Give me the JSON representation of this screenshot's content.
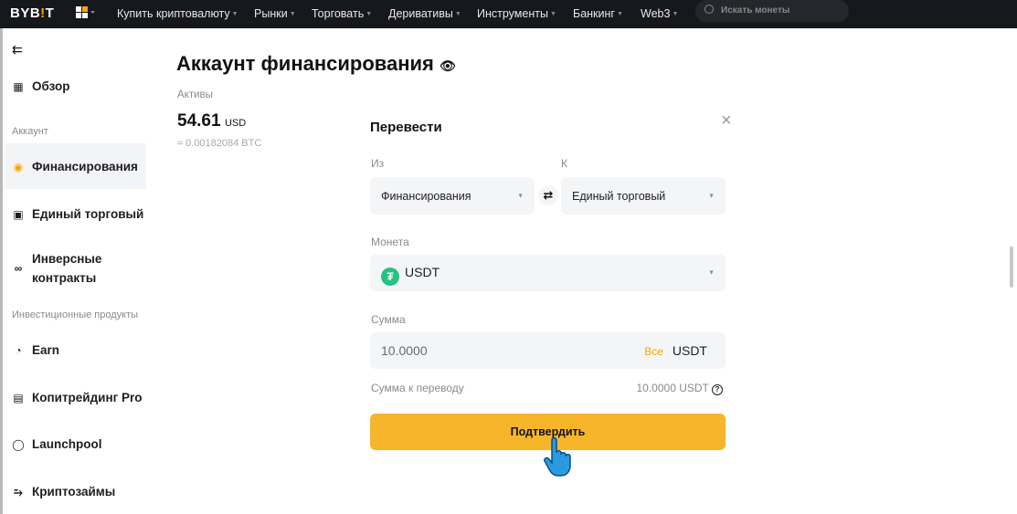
{
  "topbar": {
    "logo": "BYBIT",
    "nav": [
      "Купить криптовалюту",
      "Рынки",
      "Торговать",
      "Деривативы",
      "Инструменты",
      "Банкинг",
      "Web3"
    ],
    "search_placeholder": "Искать монеты"
  },
  "sidebar": {
    "overview": "Обзор",
    "account_label": "Аккаунт",
    "funding": "Финансирования",
    "unified": "Единый торговый",
    "inverse": [
      "Инверсные",
      "контракты"
    ],
    "invest_label": "Инвестиционные продукты",
    "earn": "Earn",
    "copy": "Копитрейдинг Pro",
    "launchpool": "Launchpool",
    "loans": "Криптозаймы"
  },
  "main": {
    "title": "Аккаунт финансирования",
    "assets_label": "Активы",
    "balance": "54.61",
    "balance_currency": "USD",
    "btc_equiv": "≈ 0.00182084 BTC"
  },
  "modal": {
    "title": "Перевести",
    "from_label": "Из",
    "to_label": "К",
    "from_value": "Финансирования",
    "to_value": "Единый торговый",
    "coin_label": "Монета",
    "coin_value": "USDT",
    "amount_label": "Сумма",
    "amount_value": "10.0000",
    "all_label": "Все",
    "amount_currency": "USDT",
    "transfer_label": "Сумма к переводу",
    "transfer_value": "10.0000 USDT",
    "confirm": "Подтвердить"
  },
  "colors": {
    "accent": "#f7b52c",
    "brand": "#f7a600",
    "usdt": "#26c281"
  }
}
